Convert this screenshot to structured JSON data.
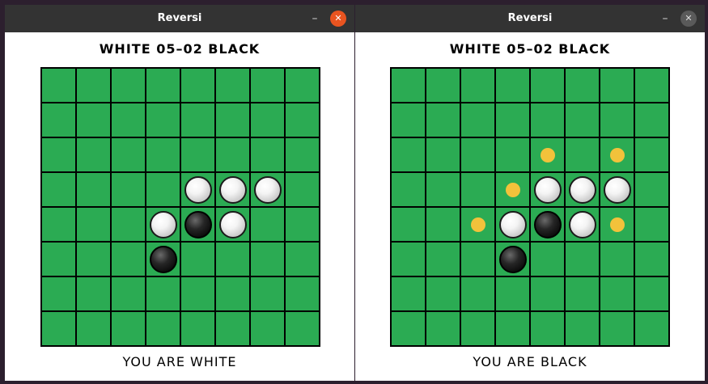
{
  "colors": {
    "board": "#2bab53",
    "grid": "#000000",
    "hint": "#f2c23b",
    "titlebar": "#333333",
    "close_active": "#e95420"
  },
  "windows": [
    {
      "id": "left",
      "title": "Reversi",
      "minimize_label": "–",
      "close_label": "✕",
      "active": true,
      "score_text": "WHITE 05–02 BLACK",
      "status_text": "YOU ARE WHITE",
      "board": [
        "........",
        "........",
        "........",
        "....WWW.",
        "...WBW..",
        "...B....",
        "........",
        "........"
      ]
    },
    {
      "id": "right",
      "title": "Reversi",
      "minimize_label": "–",
      "close_label": "✕",
      "active": false,
      "score_text": "WHITE 05–02 BLACK",
      "status_text": "YOU ARE BLACK",
      "board": [
        "........",
        "........",
        "....*.*.",
        "...*WWW.",
        "..*WBW*.",
        "...B....",
        "........",
        "........"
      ]
    }
  ]
}
